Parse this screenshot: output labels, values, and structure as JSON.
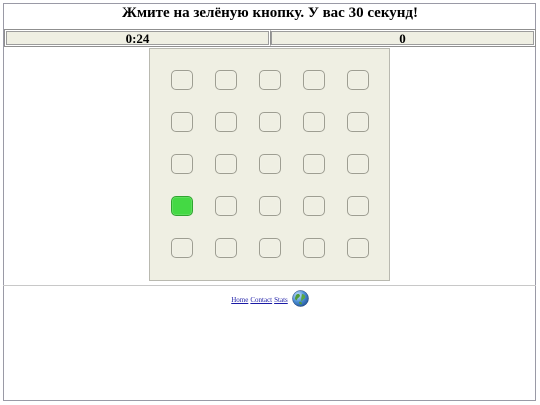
{
  "title": "Жмите на зелёную кнопку. У вас 30 секунд!",
  "status": {
    "timer": "0:24",
    "score": "0"
  },
  "board": {
    "rows": 5,
    "cols": 5,
    "green_cell": {
      "row": 4,
      "col": 1
    }
  },
  "footer": {
    "links": [
      "Home",
      "Contact",
      "Stats"
    ],
    "globe_icon": "globe-icon"
  },
  "colors": {
    "board_bg": "#efefe3",
    "green_button": "#44d944",
    "link": "#1a1aa6"
  }
}
